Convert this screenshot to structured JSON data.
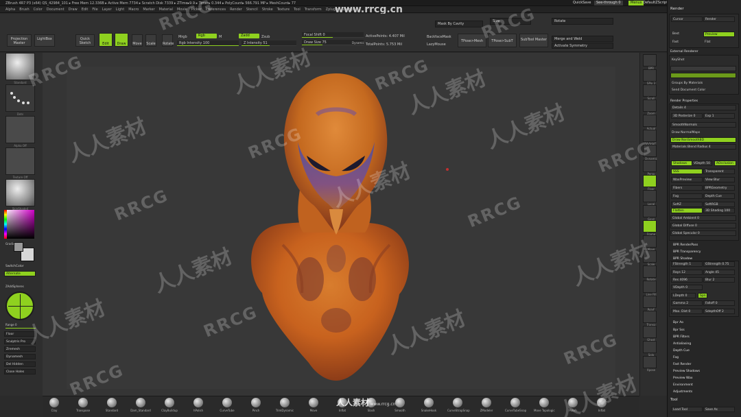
{
  "window": {
    "title": "ZBrush 4R7 P3 (x64)   QS_42984_101   ▸ Free Mem 12.336B ▸ Active Mem 7734 ▸ Scratch Disk 7339 ▸ ZTime▸9.9 ▸ Timer▸ 0.344 ▸ PolyCount▸ 566.791 MP ▸ MeshCount▸ 77",
    "quicksave": "QuickSave",
    "seethrough": "See-through  0",
    "menus_label": "Menus",
    "script": "DefaultZScript"
  },
  "menubar": {
    "items": [
      "Alpha",
      "Brush",
      "Color",
      "Document",
      "Draw",
      "Edit",
      "File",
      "Layer",
      "Light",
      "Macro",
      "Marker",
      "Material",
      "Movie",
      "Picker",
      "Preferences",
      "Render",
      "Stencil",
      "Stroke",
      "Texture",
      "Tool",
      "Transform",
      "Zplugin",
      "Zscript"
    ]
  },
  "toolbar": {
    "projection_master": "Projection Master",
    "lightbox": "LightBox",
    "quick_sketch": "Quick Sketch",
    "edit": "Edit",
    "draw": "Draw",
    "move": "Move",
    "scale": "Scale",
    "rotate": "Rotate",
    "mrgb": "Mrgb",
    "rgb": "Rgb",
    "m": "M",
    "zadd": "Zadd",
    "zsub": "Zsub",
    "rgb_intensity": "Rgb Intensity 100",
    "z_intensity": "Z Intensity 51",
    "focal_shift": "Focal Shift 0",
    "draw_size": "Draw Size 75",
    "dynamic": "Dynamic",
    "active_points": "ActivePoints: 4.407 Mil",
    "total_points": "TotalPoints: 5.753 Mil",
    "backface_mask": "BackfaceMask",
    "lazy_mouse": "LazyMouse",
    "tpose_mesh": "TPose>Mesh",
    "tpose_subt": "TPose>SubT",
    "mask_by_cavity": "Mask By Cavity",
    "size": "Size",
    "rotate_right": "Rotate",
    "auto_master": "SubTool Master",
    "merge_visible": "Merge and Weld",
    "activate_symmetry": "Activate Symmetry"
  },
  "left_shelf": {
    "brush_label": "Standard",
    "stroke_label": "Dots",
    "alpha_label": "Alpha Off",
    "texture_label": "Texture Off",
    "material_label": "SkinShade4",
    "gradient": "Gradient",
    "switch_color": "SwitchColor",
    "alternate": "Alternate",
    "subtool_label": "ZAddSpheres",
    "range_label": "Range 0",
    "buttons": [
      "Floor",
      "Sculptris Pro",
      "Zremesh",
      "Dynamesh",
      "Del Hidden",
      "Close Holes"
    ]
  },
  "right_shelf": {
    "items": [
      "BPR",
      "SPix 3",
      "Scroll",
      "Zoom",
      "Actual",
      "AAHalf",
      "Dynamic",
      "Persp",
      "Floor",
      "Local",
      "Gxyz",
      "Frame",
      "Move",
      "Scale",
      "Rotate",
      "Line Fill",
      "PolyF",
      "Transp",
      "Ghost",
      "Solo",
      "Xpose"
    ],
    "spix_label": "SPix 3",
    "persp_label": "Persp",
    "local_label": "Local"
  },
  "right_panel": {
    "title": "Render",
    "cursor": "Cursor",
    "render": "Render",
    "best": "Best",
    "preview": "Preview",
    "fast": "Fast",
    "flat": "Flat",
    "external_renderer": "External Renderer",
    "keyshot": "KeyShot",
    "groups_by_materials": "Groups By Materials",
    "send_document_color": "Send Document Color",
    "render_properties": "Render Properties",
    "details": "Details 4",
    "3d_posterize": "3D Posterize 0",
    "exp": "Exp 1",
    "smooth_normals": "SmoothNormals",
    "draw_normalmaps": "Draw NormalMaps",
    "draw_nonsmooth_bd": "Draw NonSmoothBD",
    "materials_blend_radius": "Materials Blend Radius 4",
    "shadows": "Shadows",
    "vdepth": "VDepth 50",
    "aoshader": "AOcclusion",
    "sss": "SSS",
    "transparent": "Transparent",
    "wax_preview": "WaxPreview",
    "view_blur": "View Blur",
    "fibers": "Fibers",
    "bpr_geometry": "BPRGeometry",
    "fog": "Fog",
    "depth_cue": "Depth Cue",
    "softz": "SoftZ",
    "softrgb": "SoftRGB",
    "flatten": "Flatten",
    "3d_shading": "3D Shading 100",
    "global_ambient": "Global Ambient 0",
    "global_diffuse": "Global Diffuse 0",
    "global_specular": "Global Specular 0",
    "bpr_renderpass": "BPR RenderPass",
    "bpr_transparency": "BPR Transparency",
    "bpr_shadow": "BPR Shadow",
    "fstrength": "FStrength 1",
    "gstrength": "GStrength 0.75",
    "rays": "Rays 12",
    "angle": "Angle 45",
    "res": "Res 4096",
    "blur": "Blur 2",
    "vdepth2": "VDepth 0",
    "ldepth": "LDepth 0",
    "spn": "Spn",
    "gamma": "Gamma 2",
    "falloff": "Falloff 0",
    "max_dist": "Max. Dist 0",
    "sdepthoff": "SdepthOff 2",
    "bpr_ao": "Bpr Ao",
    "bpr_sss": "Bpr Sss",
    "bpr_filters": "BPR Filters",
    "antialiasing": "Antialiasing",
    "depth_cue2": "Depth Cue",
    "fog2": "Fog",
    "fast_render": "Fast Render",
    "preview_shadows": "Preview Shadows",
    "preview_wax": "Preview Wax",
    "environment": "Environment",
    "adjustments": "Adjustments",
    "tool": "Tool",
    "load_tool": "Load Tool",
    "save_as": "Save As"
  },
  "bottom_shelf": {
    "brushes": [
      "Clay",
      "Transpose",
      "Standard",
      "Dam_Standard",
      "ClayBuildup",
      "hPolish",
      "CurveTube",
      "Pinch",
      "TrimDynamic",
      "Move",
      "Inflat",
      "Slash",
      "Smooth",
      "SnakeHook",
      "CurveStrapSnap",
      "ZModeler",
      "CurveTubeSnap",
      "Move Topologic",
      "Polish",
      "Inflat"
    ]
  },
  "watermark": {
    "site": "www.rrcg.cn",
    "cn": "人人素材",
    "en": "RRCG"
  },
  "colors": {
    "accent": "#8fd11f",
    "bg": "#2b2b2b",
    "canvas": "#353535"
  }
}
